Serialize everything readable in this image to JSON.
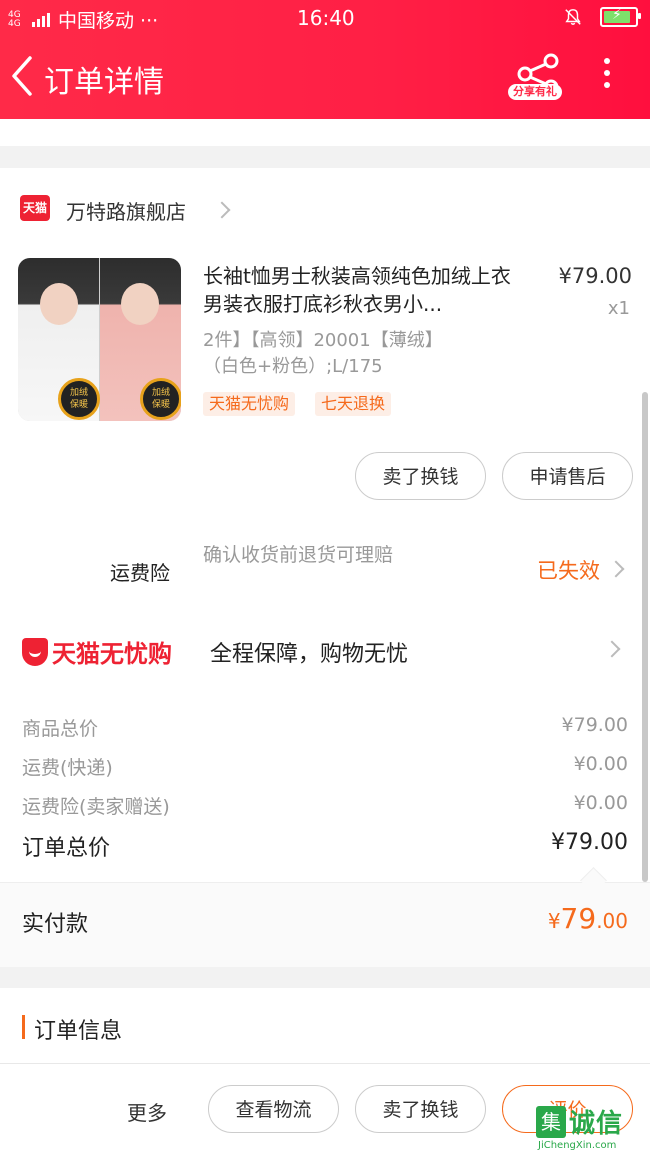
{
  "status_bar": {
    "network": "4G 4G",
    "carrier": "中国移动 ···",
    "time": "16:40"
  },
  "nav": {
    "title": "订单详情",
    "share_label": "分享有礼"
  },
  "store": {
    "badge": "天猫",
    "name": "万特路旗舰店"
  },
  "product": {
    "title": "长袖t恤男士秋装高领纯色加绒上衣男装衣服打底衫秋衣男小...",
    "price": "¥79.00",
    "quantity": "x1",
    "sku": "2件】【高领】20001【薄绒】（白色+粉色）;L/175",
    "badge_text_left": "加绒保暖",
    "badge_text_right": "加绒保暖",
    "tags": [
      "天猫无忧购",
      "七天退换"
    ],
    "buttons": [
      "卖了换钱",
      "申请售后"
    ]
  },
  "insurance": {
    "label": "运费险",
    "description": "确认收货前退货可理赔",
    "status": "已失效"
  },
  "guarantee": {
    "logo_text": "天猫无忧购",
    "text": "全程保障，购物无忧"
  },
  "summary": {
    "rows": [
      {
        "label": "商品总价",
        "value": "¥79.00"
      },
      {
        "label": "运费(快递)",
        "value": "¥0.00"
      },
      {
        "label": "运费险(卖家赠送)",
        "value": "¥0.00"
      }
    ],
    "total_label": "订单总价",
    "total_value": "¥79.00",
    "paid_label": "实付款",
    "paid_currency": "¥",
    "paid_integer": "79",
    "paid_decimal": ".00"
  },
  "order_info": {
    "title": "订单信息"
  },
  "bottom_bar": {
    "more": "更多",
    "buttons": [
      "查看物流",
      "卖了换钱",
      "评价"
    ]
  },
  "watermark": {
    "char": "集",
    "text": "诚信",
    "url": "JiChengXin.com"
  },
  "colors": {
    "brand_red": "#ff2a48",
    "accent_orange": "#f56a1c",
    "tmall_red": "#ee2233"
  }
}
